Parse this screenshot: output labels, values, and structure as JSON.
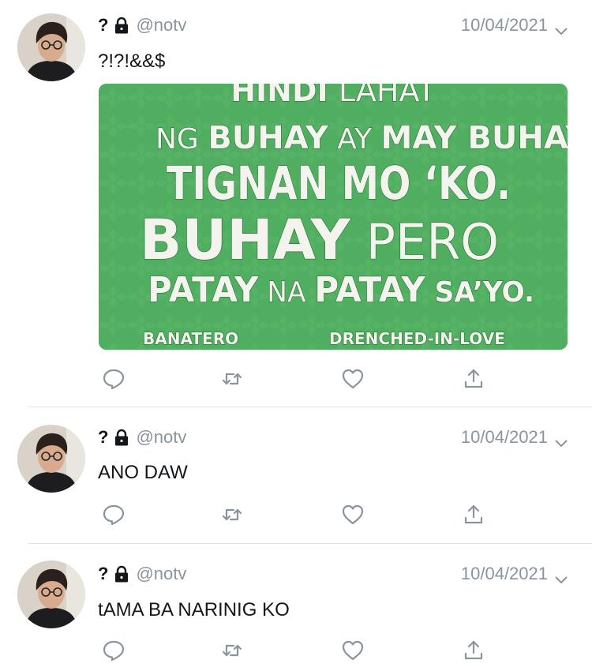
{
  "colors": {
    "text": "#14171a",
    "secondary": "#8a949e",
    "separator": "#dfe3e6",
    "icon": "#8a949e",
    "media_green": "#4fae5f"
  },
  "tweets": [
    {
      "name": "?",
      "handle": "@notv",
      "date": "10/04/2021",
      "text": "?!?!&&$",
      "media": {
        "lines": [
          {
            "segments": [
              {
                "t": "HINDI LAHAT"
              }
            ]
          },
          {
            "segments": [
              {
                "t": "NG "
              },
              {
                "t": "BUHAY"
              },
              {
                "t": " AY "
              },
              {
                "t": "MAY BUHAY"
              },
              {
                "t": "."
              }
            ]
          },
          {
            "segments": [
              {
                "t": "TIGNAN MO ‘KO."
              }
            ]
          },
          {
            "segments": [
              {
                "t": "BUHAY"
              },
              {
                "t": " PERO"
              }
            ]
          },
          {
            "segments": [
              {
                "t": "PATAY"
              },
              {
                "t": " NA "
              },
              {
                "t": "PATAY"
              },
              {
                "t": " SA’YO."
              }
            ]
          }
        ],
        "credit_left": "BANATERO",
        "credit_right": "DRENCHED-IN-LOVE"
      }
    },
    {
      "name": "?",
      "handle": "@notv",
      "date": "10/04/2021",
      "text": "ANO DAW"
    },
    {
      "name": "?",
      "handle": "@notv",
      "date": "10/04/2021",
      "text": "tAMA BA NARINIG KO"
    }
  ],
  "icons": {
    "lock": "lock-icon",
    "chevron": "chevron-down-icon",
    "reply": "reply-icon",
    "retweet": "retweet-icon",
    "like": "heart-icon",
    "share": "share-icon"
  }
}
